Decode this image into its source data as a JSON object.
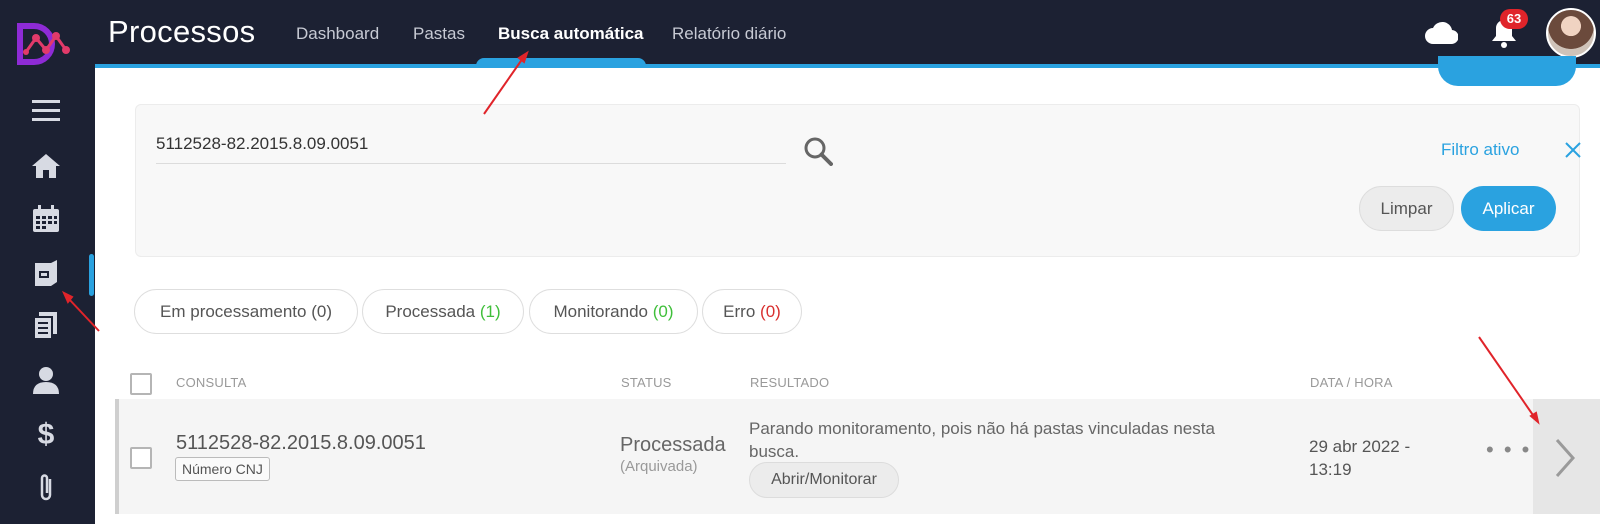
{
  "header": {
    "app_title": "Processos",
    "tabs": [
      {
        "label": "Dashboard",
        "active": false
      },
      {
        "label": "Pastas",
        "active": false
      },
      {
        "label": "Busca automática",
        "active": true
      },
      {
        "label": "Relatório diário",
        "active": false
      }
    ],
    "notification_count": "63",
    "icons": [
      "cloud-icon",
      "bell-icon",
      "avatar"
    ]
  },
  "sidebar": {
    "items": [
      {
        "icon": "menu-icon"
      },
      {
        "icon": "home-icon"
      },
      {
        "icon": "calendar-icon"
      },
      {
        "icon": "folder-icon",
        "active": true
      },
      {
        "icon": "documents-icon"
      },
      {
        "icon": "user-icon"
      },
      {
        "icon": "dollar-icon"
      },
      {
        "icon": "paperclip-icon"
      }
    ]
  },
  "filter": {
    "search_value": "5112528-82.2015.8.09.0051",
    "filter_active_label": "Filtro ativo",
    "clear_label": "Limpar",
    "apply_label": "Aplicar"
  },
  "status_chips": [
    {
      "label": "Em processamento",
      "count": "(0)"
    },
    {
      "label": "Processada",
      "count": "(1)"
    },
    {
      "label": "Monitorando",
      "count": "(0)"
    },
    {
      "label": "Erro",
      "count": "(0)"
    }
  ],
  "table": {
    "headers": {
      "consulta": "CONSULTA",
      "status": "STATUS",
      "resultado": "RESULTADO",
      "data_hora": "DATA / HORA"
    },
    "rows": [
      {
        "consulta": "5112528-82.2015.8.09.0051",
        "tag": "Número CNJ",
        "status": "Processada",
        "status_sub": "(Arquivada)",
        "resultado": "Parando monitoramento, pois não há pastas vinculadas nesta busca.",
        "action_label": "Abrir/Monitorar",
        "data_hora": "29 abr 2022 - 13:19",
        "more": "• • •"
      }
    ]
  },
  "colors": {
    "sidebar_bg": "#1c2133",
    "accent": "#2aa2e0",
    "badge": "#e0242a",
    "green": "#3fbf3a",
    "red": "#d9302f"
  }
}
